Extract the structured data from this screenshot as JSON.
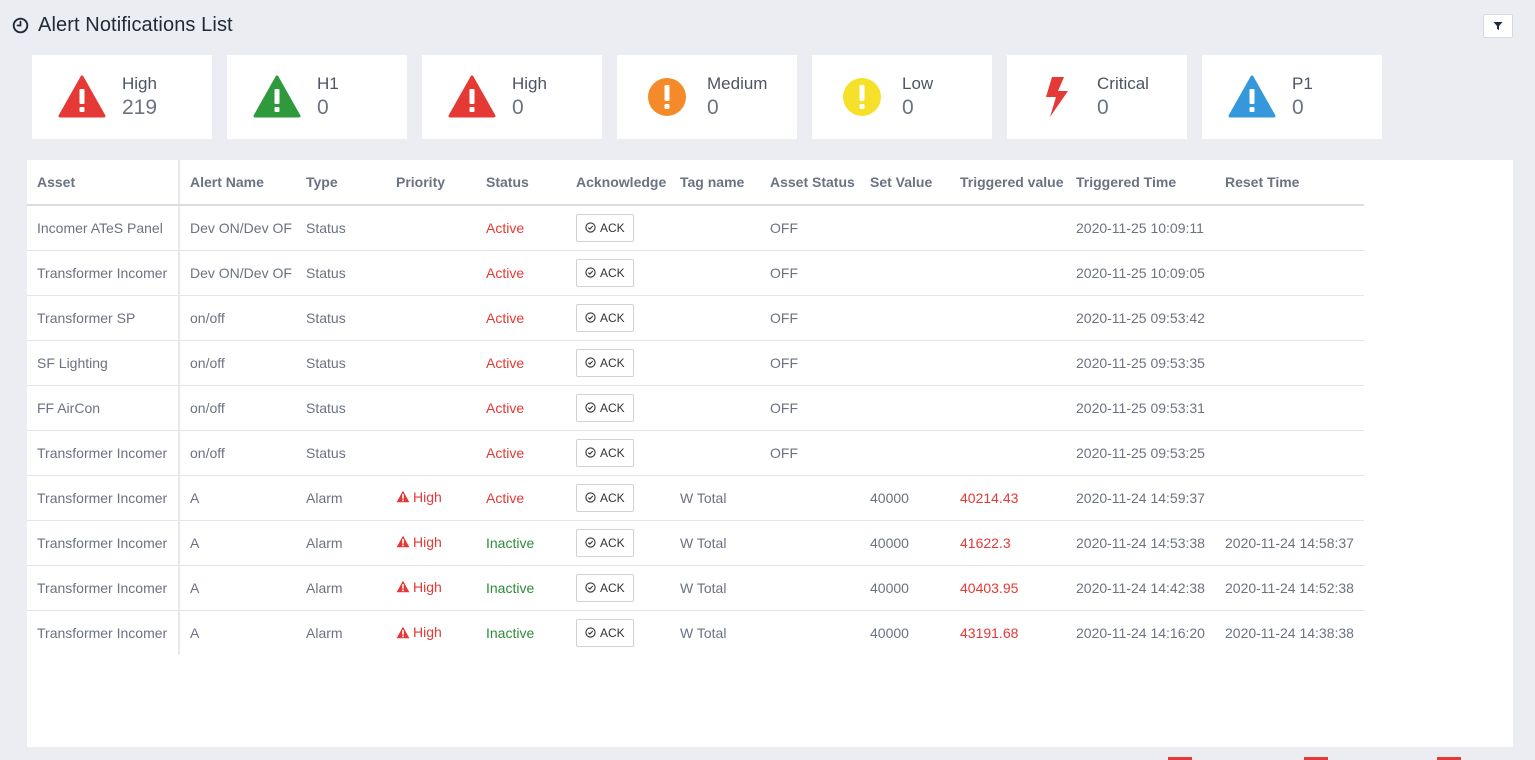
{
  "page": {
    "title": "Alert Notifications List"
  },
  "summary": [
    {
      "label": "High",
      "count": "219",
      "icon": "warning-triangle-icon",
      "color": "#e53935"
    },
    {
      "label": "H1",
      "count": "0",
      "icon": "warning-triangle-icon",
      "color": "#2e9a3d"
    },
    {
      "label": "High",
      "count": "0",
      "icon": "warning-triangle-icon",
      "color": "#e53935"
    },
    {
      "label": "Medium",
      "count": "0",
      "icon": "exclamation-circle-icon",
      "color": "#f58a2a"
    },
    {
      "label": "Low",
      "count": "0",
      "icon": "exclamation-circle-icon",
      "color": "#f5e12a"
    },
    {
      "label": "Critical",
      "count": "0",
      "icon": "lightning-bolt-icon",
      "color": "#e53935"
    },
    {
      "label": "P1",
      "count": "0",
      "icon": "warning-triangle-icon",
      "color": "#3498db"
    }
  ],
  "table": {
    "columns": [
      "Asset",
      "Alert Name",
      "Type",
      "Priority",
      "Status",
      "Acknowledge",
      "Tag name",
      "Asset Status",
      "Set Value",
      "Triggered value",
      "Triggered Time",
      "Reset Time"
    ],
    "ack_label": "ACK",
    "rows": [
      {
        "asset": "Incomer ATeS Panel",
        "alert_name": "Dev ON/Dev OF",
        "type": "Status",
        "priority": "",
        "status": "Active",
        "tag": "",
        "asset_status": "OFF",
        "set_value": "",
        "triggered_value": "",
        "triggered_time": "2020-11-25 10:09:11",
        "reset_time": ""
      },
      {
        "asset": "Transformer Incomer",
        "alert_name": "Dev ON/Dev OF",
        "type": "Status",
        "priority": "",
        "status": "Active",
        "tag": "",
        "asset_status": "OFF",
        "set_value": "",
        "triggered_value": "",
        "triggered_time": "2020-11-25 10:09:05",
        "reset_time": ""
      },
      {
        "asset": "Transformer SP",
        "alert_name": "on/off",
        "type": "Status",
        "priority": "",
        "status": "Active",
        "tag": "",
        "asset_status": "OFF",
        "set_value": "",
        "triggered_value": "",
        "triggered_time": "2020-11-25 09:53:42",
        "reset_time": ""
      },
      {
        "asset": "SF Lighting",
        "alert_name": "on/off",
        "type": "Status",
        "priority": "",
        "status": "Active",
        "tag": "",
        "asset_status": "OFF",
        "set_value": "",
        "triggered_value": "",
        "triggered_time": "2020-11-25 09:53:35",
        "reset_time": ""
      },
      {
        "asset": "FF AirCon",
        "alert_name": "on/off",
        "type": "Status",
        "priority": "",
        "status": "Active",
        "tag": "",
        "asset_status": "OFF",
        "set_value": "",
        "triggered_value": "",
        "triggered_time": "2020-11-25 09:53:31",
        "reset_time": ""
      },
      {
        "asset": "Transformer Incomer",
        "alert_name": "on/off",
        "type": "Status",
        "priority": "",
        "status": "Active",
        "tag": "",
        "asset_status": "OFF",
        "set_value": "",
        "triggered_value": "",
        "triggered_time": "2020-11-25 09:53:25",
        "reset_time": ""
      },
      {
        "asset": "Transformer Incomer",
        "alert_name": "A",
        "type": "Alarm",
        "priority": "High",
        "status": "Active",
        "tag": "W Total",
        "asset_status": "",
        "set_value": "40000",
        "triggered_value": "40214.43",
        "triggered_time": "2020-11-24 14:59:37",
        "reset_time": ""
      },
      {
        "asset": "Transformer Incomer",
        "alert_name": "A",
        "type": "Alarm",
        "priority": "High",
        "status": "Inactive",
        "tag": "W Total",
        "asset_status": "",
        "set_value": "40000",
        "triggered_value": "41622.3",
        "triggered_time": "2020-11-24 14:53:38",
        "reset_time": "2020-11-24 14:58:37"
      },
      {
        "asset": "Transformer Incomer",
        "alert_name": "A",
        "type": "Alarm",
        "priority": "High",
        "status": "Inactive",
        "tag": "W Total",
        "asset_status": "",
        "set_value": "40000",
        "triggered_value": "40403.95",
        "triggered_time": "2020-11-24 14:42:38",
        "reset_time": "2020-11-24 14:52:38"
      },
      {
        "asset": "Transformer Incomer",
        "alert_name": "A",
        "type": "Alarm",
        "priority": "High",
        "status": "Inactive",
        "tag": "W Total",
        "asset_status": "",
        "set_value": "40000",
        "triggered_value": "43191.68",
        "triggered_time": "2020-11-24 14:16:20",
        "reset_time": "2020-11-24 14:38:38"
      }
    ]
  },
  "colors": {
    "active": "#e53935",
    "inactive": "#2e8b3a",
    "triggered_value": "#e53935",
    "priority_high": "#e53935"
  }
}
